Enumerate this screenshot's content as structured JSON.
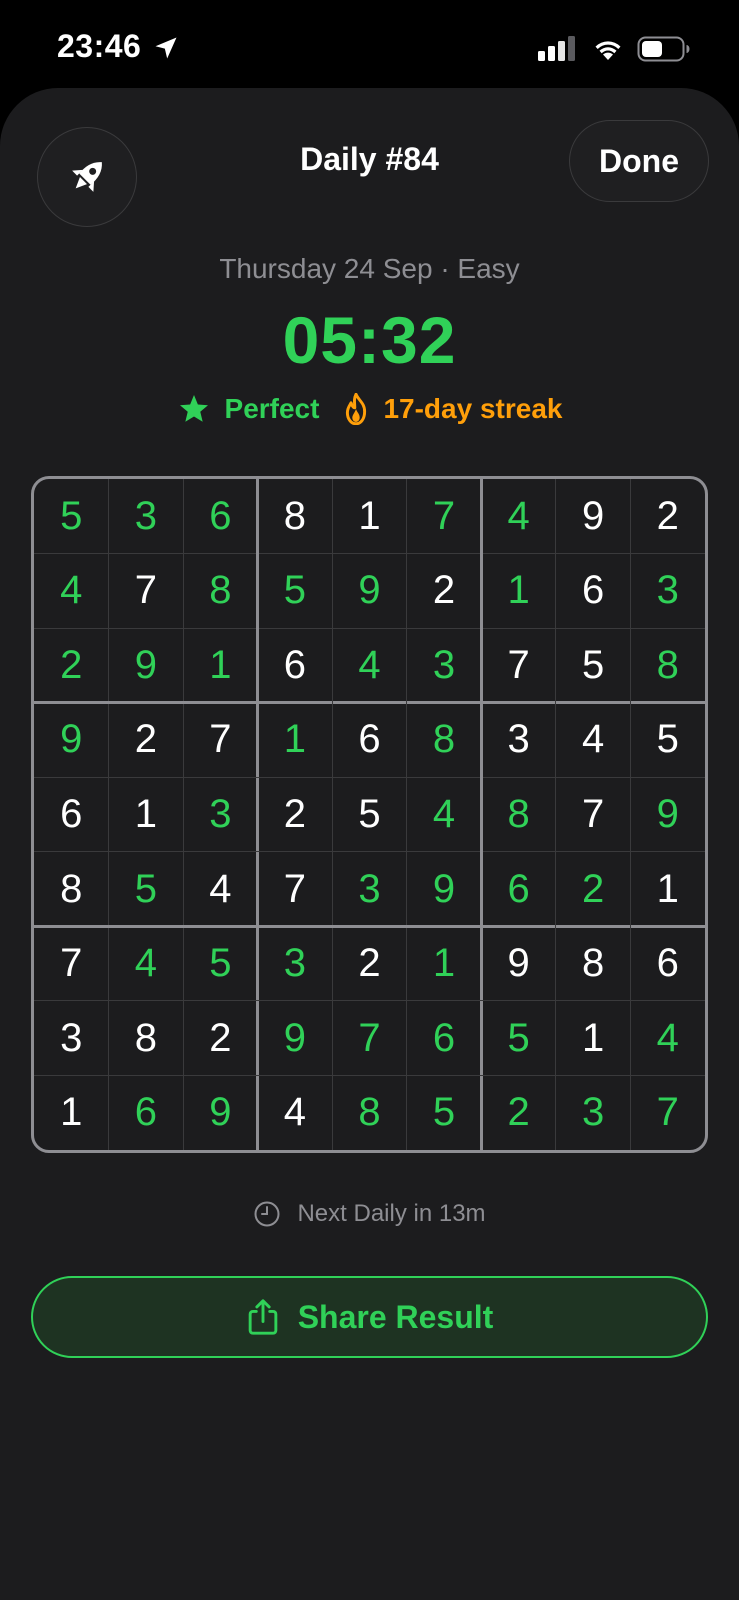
{
  "status_bar": {
    "time": "23:46"
  },
  "header": {
    "title": "Daily #84",
    "done_label": "Done",
    "left_icon": "rocket-icon"
  },
  "summary": {
    "subtitle": "Thursday 24 Sep · Easy",
    "timer": "05:32",
    "perfect_label": "Perfect",
    "streak_label": "17-day streak"
  },
  "board": {
    "values": [
      [
        5,
        3,
        6,
        8,
        1,
        7,
        4,
        9,
        2
      ],
      [
        4,
        7,
        8,
        5,
        9,
        2,
        1,
        6,
        3
      ],
      [
        2,
        9,
        1,
        6,
        4,
        3,
        7,
        5,
        8
      ],
      [
        9,
        2,
        7,
        1,
        6,
        8,
        3,
        4,
        5
      ],
      [
        6,
        1,
        3,
        2,
        5,
        4,
        8,
        7,
        9
      ],
      [
        8,
        5,
        4,
        7,
        3,
        9,
        6,
        2,
        1
      ],
      [
        7,
        4,
        5,
        3,
        2,
        1,
        9,
        8,
        6
      ],
      [
        3,
        8,
        2,
        9,
        7,
        6,
        5,
        1,
        4
      ],
      [
        1,
        6,
        9,
        4,
        8,
        5,
        2,
        3,
        7
      ]
    ],
    "solved_mask": [
      [
        1,
        1,
        1,
        0,
        0,
        1,
        1,
        0,
        0
      ],
      [
        1,
        0,
        1,
        1,
        1,
        0,
        1,
        0,
        1
      ],
      [
        1,
        1,
        1,
        0,
        1,
        1,
        0,
        0,
        1
      ],
      [
        1,
        0,
        0,
        1,
        0,
        1,
        0,
        0,
        0
      ],
      [
        0,
        0,
        1,
        0,
        0,
        1,
        1,
        0,
        1
      ],
      [
        0,
        1,
        0,
        0,
        1,
        1,
        1,
        1,
        0
      ],
      [
        0,
        1,
        1,
        1,
        0,
        1,
        0,
        0,
        0
      ],
      [
        0,
        0,
        0,
        1,
        1,
        1,
        1,
        0,
        1
      ],
      [
        0,
        1,
        1,
        0,
        1,
        1,
        1,
        1,
        1
      ]
    ]
  },
  "footer": {
    "next_daily": "Next Daily in 13m",
    "share_label": "Share Result"
  },
  "colors": {
    "accent": "#30d158",
    "streak": "#ff9f0a",
    "background": "#1c1c1e",
    "muted": "#8e8e93"
  }
}
